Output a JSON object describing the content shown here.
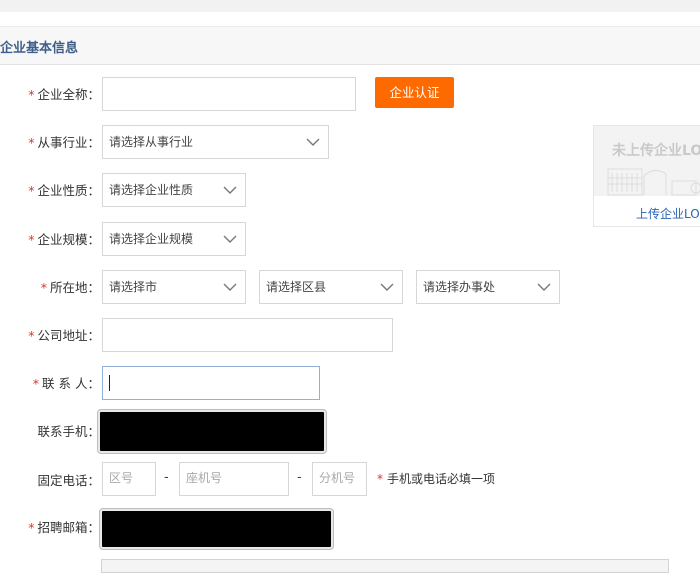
{
  "section": {
    "title": "企业基本信息"
  },
  "form": {
    "company_name": {
      "label": "企业全称：",
      "value": ""
    },
    "verify_button": "企业认证",
    "industry": {
      "label": "从事行业：",
      "selected": "请选择从事行业"
    },
    "nature": {
      "label": "企业性质：",
      "selected": "请选择企业性质"
    },
    "scale": {
      "label": "企业规模：",
      "selected": "请选择企业规模"
    },
    "location": {
      "label": "所在地：",
      "city": "请选择市",
      "district": "请选择区县",
      "office": "请选择办事处"
    },
    "address": {
      "label": "公司地址：",
      "value": ""
    },
    "contact": {
      "label": "联 系 人：",
      "value": ""
    },
    "mobile": {
      "label": "联系手机："
    },
    "phone": {
      "label": "固定电话：",
      "area_placeholder": "区号",
      "number_placeholder": "座机号",
      "ext_placeholder": "分机号",
      "separator": "-",
      "hint": "手机或电话必填一项"
    },
    "email": {
      "label": "招聘邮箱："
    }
  },
  "logo": {
    "caption": "未上传企业LOGO",
    "upload_link": "上传企业LOGO"
  },
  "colors": {
    "accent": "#ff6a00",
    "required": "#e0342a",
    "link": "#2a64b6",
    "title": "#3f5f8a"
  }
}
